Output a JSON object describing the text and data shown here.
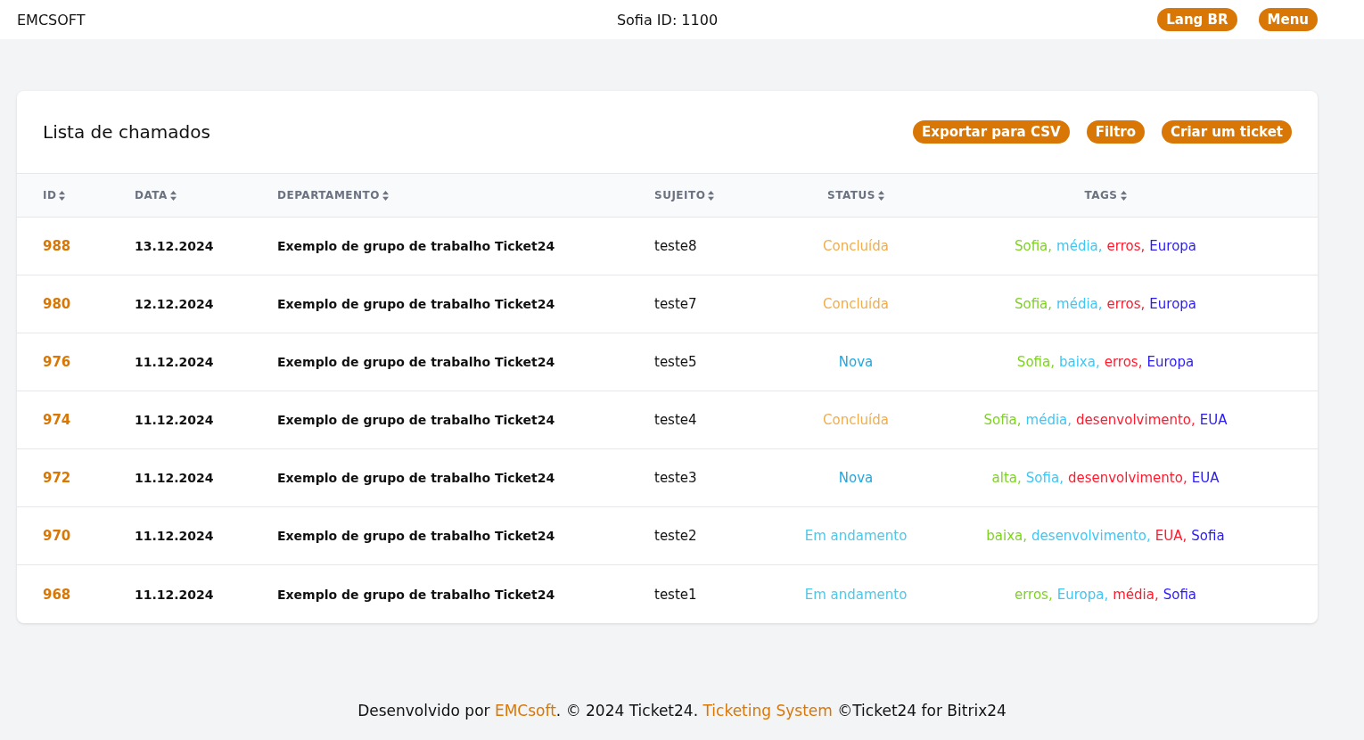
{
  "topbar": {
    "brand": "EMCSOFT",
    "user_id": "Sofia ID: 1100",
    "buttons": [
      "Lang BR",
      "Menu"
    ]
  },
  "card": {
    "title": "Lista de chamados",
    "actions": [
      "Exportar para CSV",
      "Filtro",
      "Criar um ticket"
    ]
  },
  "table": {
    "columns": [
      "ID",
      "DATA",
      "DEPARTAMENTO",
      "SUJEITO",
      "STATUS",
      "TAGS"
    ],
    "rows": [
      {
        "id": "988",
        "date": "13.12.2024",
        "department": "Exemplo de grupo de trabalho Ticket24",
        "subject": "teste8",
        "status": {
          "text": "Concluída",
          "color": "#f0ad4e"
        },
        "tags": [
          {
            "text": "Sofia,",
            "color": "#7ed321"
          },
          {
            "text": "média,",
            "color": "#3fc6f5"
          },
          {
            "text": "erros,",
            "color": "#ff1a2e"
          },
          {
            "text": "Europa",
            "color": "#2b1bf5"
          }
        ]
      },
      {
        "id": "980",
        "date": "12.12.2024",
        "department": "Exemplo de grupo de trabalho Ticket24",
        "subject": "teste7",
        "status": {
          "text": "Concluída",
          "color": "#f0ad4e"
        },
        "tags": [
          {
            "text": "Sofia,",
            "color": "#7ed321"
          },
          {
            "text": "média,",
            "color": "#3fc6f5"
          },
          {
            "text": "erros,",
            "color": "#ff1a2e"
          },
          {
            "text": "Europa",
            "color": "#2b1bf5"
          }
        ]
      },
      {
        "id": "976",
        "date": "11.12.2024",
        "department": "Exemplo de grupo de trabalho Ticket24",
        "subject": "teste5",
        "status": {
          "text": "Nova",
          "color": "#22a7e0"
        },
        "tags": [
          {
            "text": "Sofia,",
            "color": "#7ed321"
          },
          {
            "text": "baixa,",
            "color": "#3fc6f5"
          },
          {
            "text": "erros,",
            "color": "#ff1a2e"
          },
          {
            "text": "Europa",
            "color": "#2b1bf5"
          }
        ]
      },
      {
        "id": "974",
        "date": "11.12.2024",
        "department": "Exemplo de grupo de trabalho Ticket24",
        "subject": "teste4",
        "status": {
          "text": "Concluída",
          "color": "#f0ad4e"
        },
        "tags": [
          {
            "text": "Sofia,",
            "color": "#7ed321"
          },
          {
            "text": "média,",
            "color": "#3fc6f5"
          },
          {
            "text": "desenvolvimento,",
            "color": "#ff1a2e"
          },
          {
            "text": "EUA",
            "color": "#2b1bf5"
          }
        ]
      },
      {
        "id": "972",
        "date": "11.12.2024",
        "department": "Exemplo de grupo de trabalho Ticket24",
        "subject": "teste3",
        "status": {
          "text": "Nova",
          "color": "#22a7e0"
        },
        "tags": [
          {
            "text": "alta,",
            "color": "#7ed321"
          },
          {
            "text": "Sofia,",
            "color": "#3fc6f5"
          },
          {
            "text": "desenvolvimento,",
            "color": "#ff1a2e"
          },
          {
            "text": "EUA",
            "color": "#2b1bf5"
          }
        ]
      },
      {
        "id": "970",
        "date": "11.12.2024",
        "department": "Exemplo de grupo de trabalho Ticket24",
        "subject": "teste2",
        "status": {
          "text": "Em andamento",
          "color": "#4fc8e8"
        },
        "tags": [
          {
            "text": "baixa,",
            "color": "#7ed321"
          },
          {
            "text": "desenvolvimento,",
            "color": "#3fc6f5"
          },
          {
            "text": "EUA,",
            "color": "#ff1a2e"
          },
          {
            "text": "Sofia",
            "color": "#2b1bf5"
          }
        ]
      },
      {
        "id": "968",
        "date": "11.12.2024",
        "department": "Exemplo de grupo de trabalho Ticket24",
        "subject": "teste1",
        "status": {
          "text": "Em andamento",
          "color": "#4fc8e8"
        },
        "tags": [
          {
            "text": "erros,",
            "color": "#7ed321"
          },
          {
            "text": "Europa,",
            "color": "#3fc6f5"
          },
          {
            "text": "média,",
            "color": "#ff1a2e"
          },
          {
            "text": "Sofia",
            "color": "#2b1bf5"
          }
        ]
      }
    ]
  },
  "footer": {
    "parts": [
      {
        "kind": "text",
        "text": "Desenvolvido por "
      },
      {
        "kind": "link",
        "text": "EMCsoft"
      },
      {
        "kind": "text",
        "text": ". © 2024 Ticket24. "
      },
      {
        "kind": "link",
        "text": "Ticketing System"
      },
      {
        "kind": "text",
        "text": " ©Ticket24 for Bitrix24"
      }
    ]
  }
}
